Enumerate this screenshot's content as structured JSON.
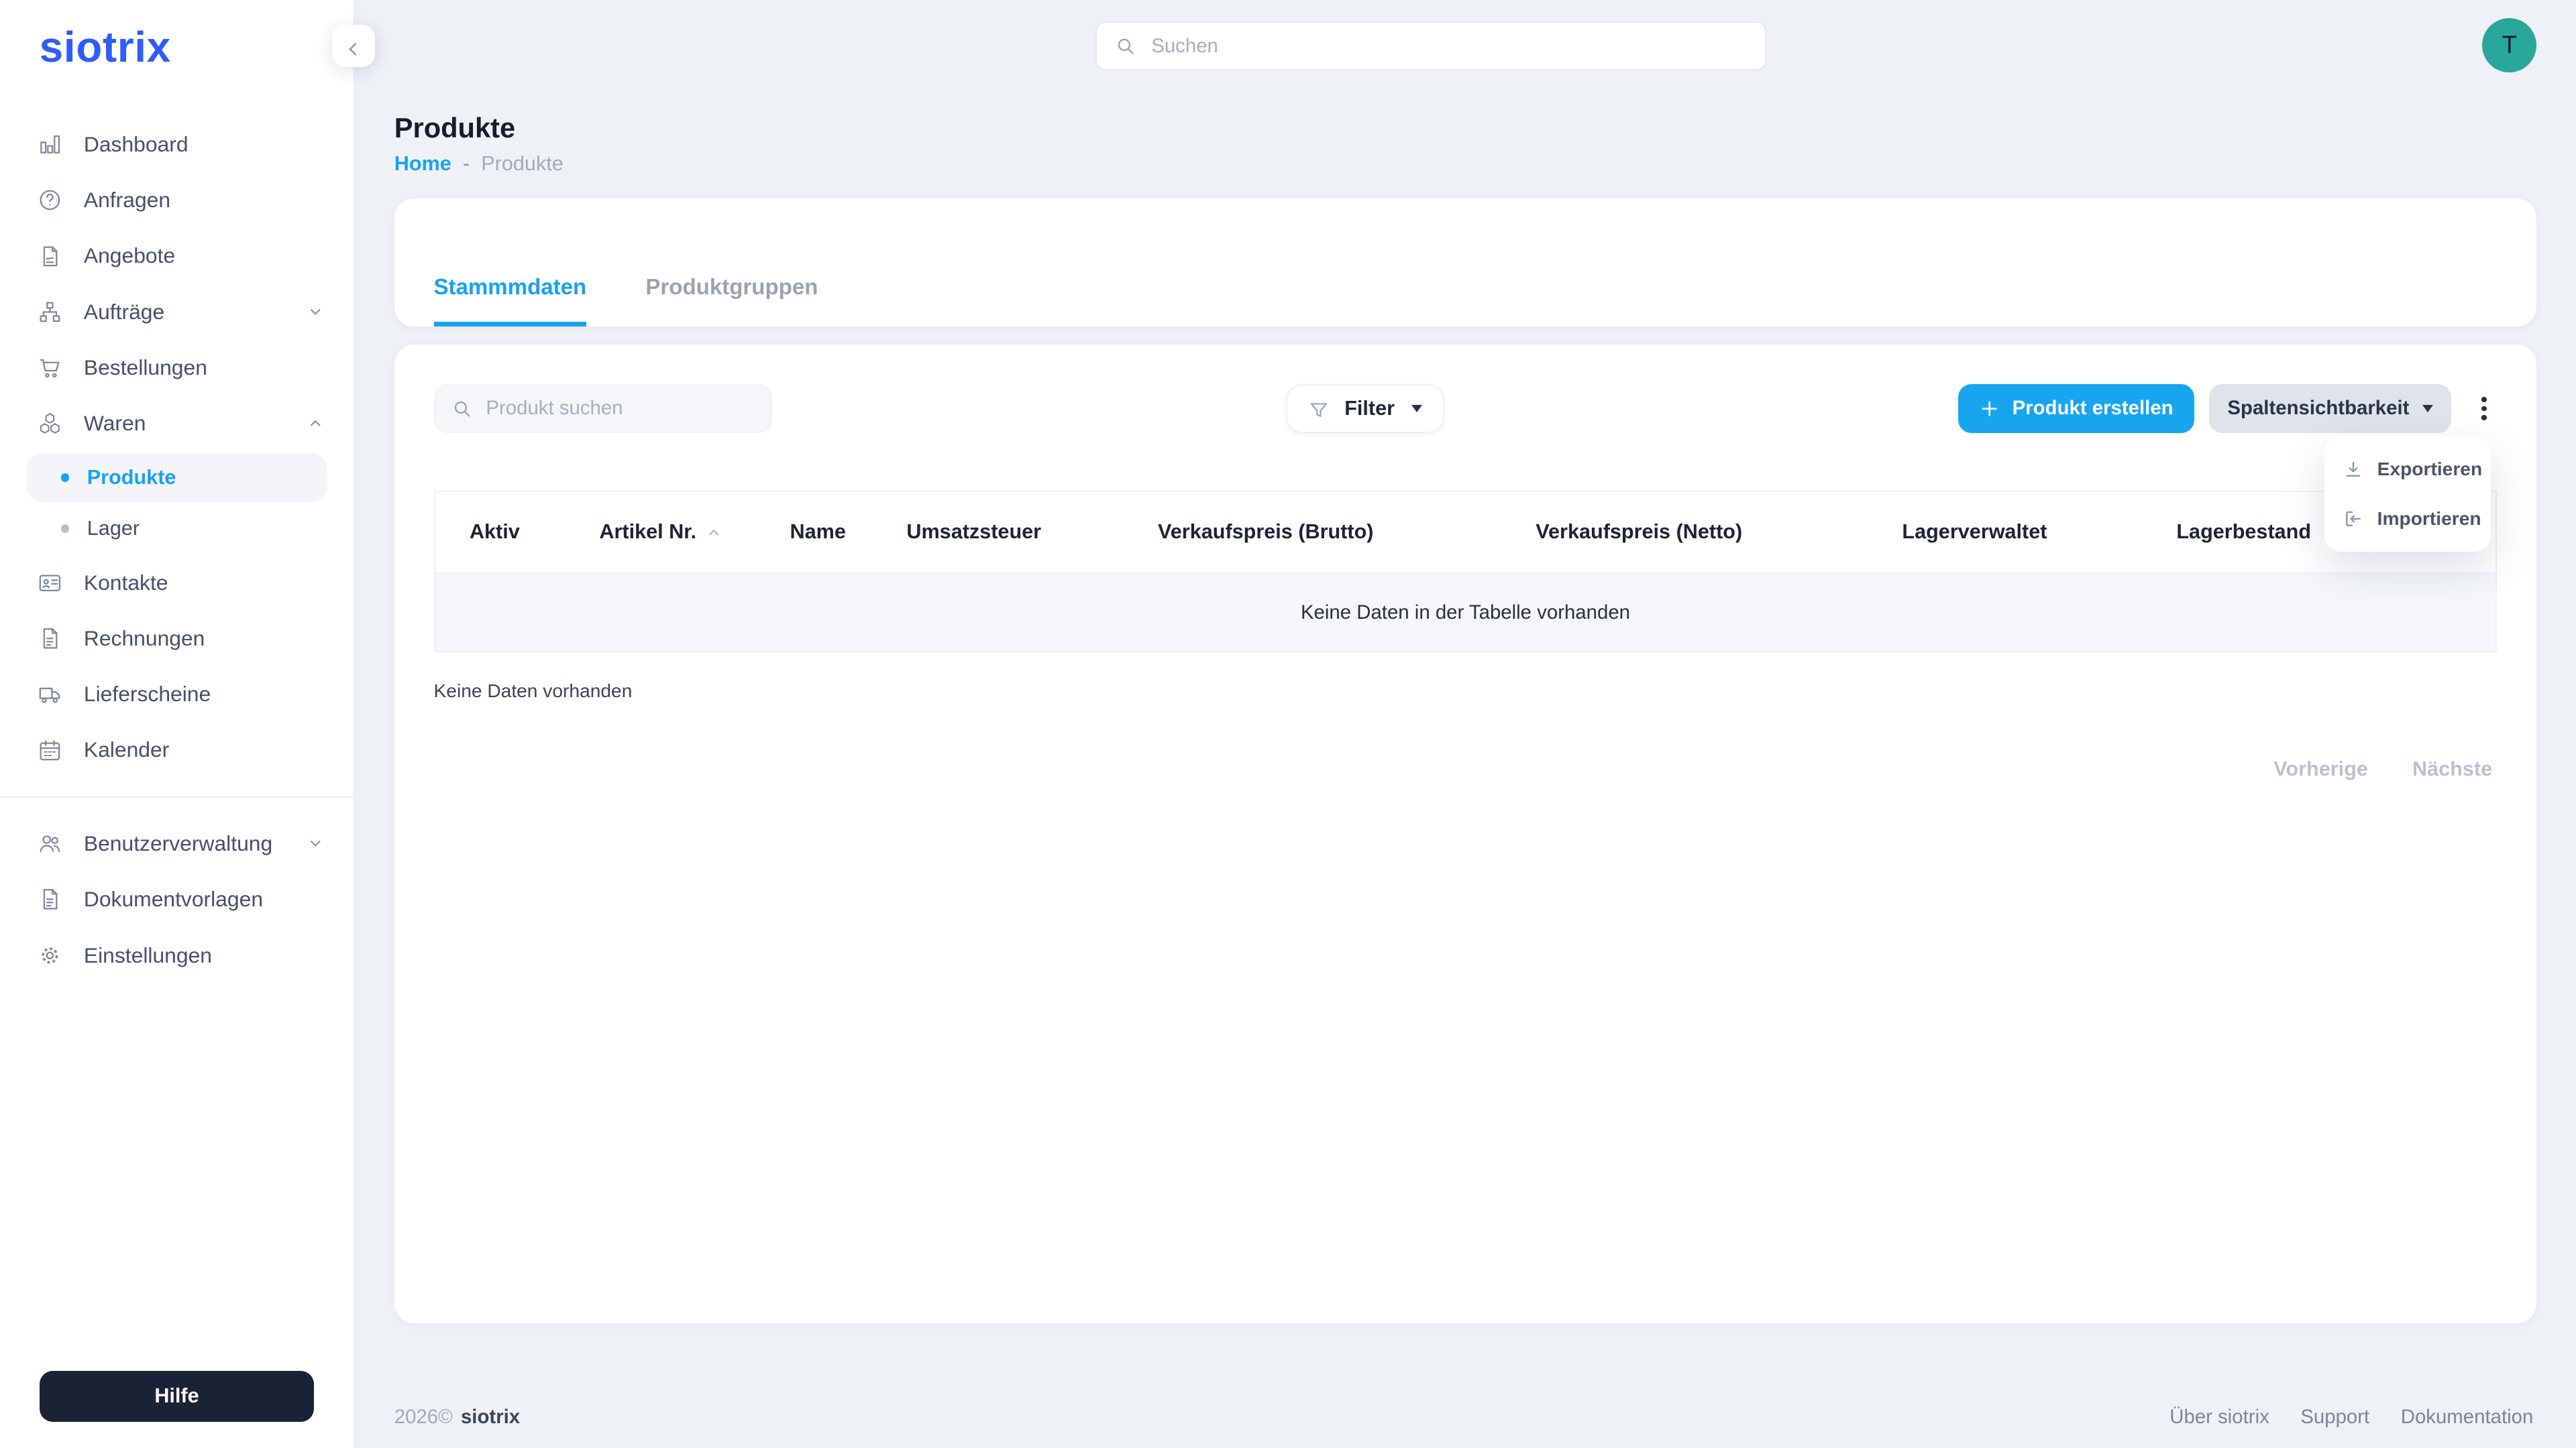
{
  "brand": {
    "logo": "siotrix"
  },
  "header": {
    "search_placeholder": "Suchen",
    "avatar_initial": "T"
  },
  "sidebar": {
    "items": [
      {
        "label": "Dashboard",
        "icon": "bar-chart-icon"
      },
      {
        "label": "Anfragen",
        "icon": "question-circle-icon"
      },
      {
        "label": "Angebote",
        "icon": "document-signature-icon"
      },
      {
        "label": "Aufträge",
        "icon": "sitemap-icon",
        "chevron": "down"
      },
      {
        "label": "Bestellungen",
        "icon": "cart-icon"
      },
      {
        "label": "Waren",
        "icon": "cubes-icon",
        "chevron": "up",
        "expanded": true
      },
      {
        "label": "Produkte",
        "active": true
      },
      {
        "label": "Lager"
      },
      {
        "label": "Kontakte",
        "icon": "contact-card-icon"
      },
      {
        "label": "Rechnungen",
        "icon": "invoice-icon"
      },
      {
        "label": "Lieferscheine",
        "icon": "truck-icon"
      },
      {
        "label": "Kalender",
        "icon": "calendar-icon"
      },
      {
        "label": "Benutzerverwaltung",
        "icon": "users-icon",
        "chevron": "down"
      },
      {
        "label": "Dokumentvorlagen",
        "icon": "document-icon"
      },
      {
        "label": "Einstellungen",
        "icon": "gear-icon"
      }
    ],
    "help_label": "Hilfe"
  },
  "page": {
    "title": "Produkte",
    "breadcrumb": {
      "home": "Home",
      "separator": "-",
      "current": "Produkte"
    }
  },
  "tabs": [
    {
      "label": "Stammmdaten",
      "active": true
    },
    {
      "label": "Produktgruppen",
      "active": false
    }
  ],
  "toolbar": {
    "search_placeholder": "Produkt suchen",
    "filter_label": "Filter",
    "create_label": "Produkt erstellen",
    "columns_label": "Spaltensichtbarkeit"
  },
  "menu": {
    "items": [
      {
        "label": "Exportieren",
        "icon": "download-icon"
      },
      {
        "label": "Importieren",
        "icon": "import-icon"
      }
    ]
  },
  "table": {
    "columns": [
      "Aktiv",
      "Artikel Nr.",
      "Name",
      "Umsatzsteuer",
      "Verkaufspreis (Brutto)",
      "Verkaufspreis (Netto)",
      "Lagerverwaltet",
      "Lagerbestand"
    ],
    "sorted_column": "Artikel Nr.",
    "sort_direction": "asc",
    "empty_text": "Keine Daten in der Tabelle vorhanden",
    "no_data_text": "Keine Daten vorhanden"
  },
  "pagination": {
    "prev": "Vorherige",
    "next": "Nächste"
  },
  "footer": {
    "year": "2026©",
    "brand": "siotrix",
    "links": [
      "Über siotrix",
      "Support",
      "Dokumentation"
    ]
  },
  "colors": {
    "accent_blue": "#17a3f3",
    "logo_blue": "#2e5cf6",
    "avatar_teal": "#2aa79b",
    "dark_navy": "#1a2336",
    "page_bg": "#eef1f6"
  }
}
